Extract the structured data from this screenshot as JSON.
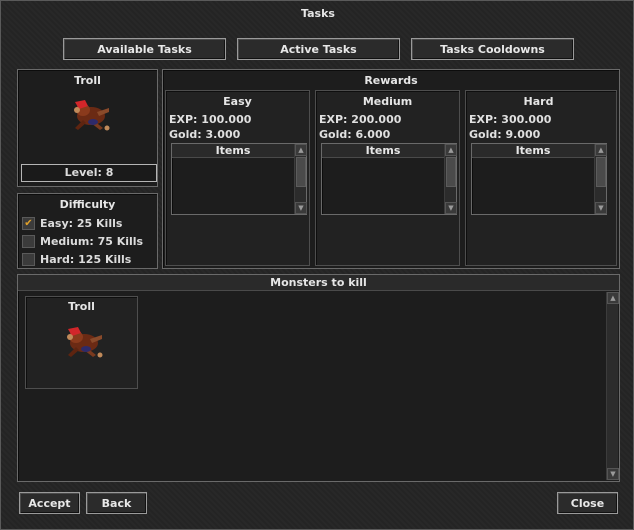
{
  "window": {
    "title": "Tasks"
  },
  "tabs": {
    "available": "Available Tasks",
    "active": "Active Tasks",
    "cooldowns": "Tasks Cooldowns"
  },
  "monster": {
    "name": "Troll",
    "level": "Level: 8"
  },
  "difficulty": {
    "title": "Difficulty",
    "options": [
      {
        "label": "Easy: 25 Kills",
        "checked": true
      },
      {
        "label": "Medium: 75 Kills",
        "checked": false
      },
      {
        "label": "Hard: 125 Kills",
        "checked": false
      }
    ]
  },
  "rewards": {
    "title": "Rewards",
    "items_label": "Items",
    "tiers": [
      {
        "name": "Easy",
        "exp": "EXP: 100.000",
        "gold": "Gold: 3.000"
      },
      {
        "name": "Medium",
        "exp": "EXP: 200.000",
        "gold": "Gold: 6.000"
      },
      {
        "name": "Hard",
        "exp": "EXP: 300.000",
        "gold": "Gold: 9.000"
      }
    ]
  },
  "monsters_to_kill": {
    "title": "Monsters to kill",
    "list": [
      {
        "name": "Troll"
      }
    ]
  },
  "footer": {
    "accept": "Accept",
    "back": "Back",
    "close": "Close"
  },
  "icons": {
    "checkmark": "checkmark-icon",
    "scroll_up": "arrow-up-icon",
    "scroll_down": "arrow-down-icon",
    "monster_sprite": "troll-sprite-icon"
  },
  "colors": {
    "check": "#e0a02a",
    "window_bg": "#252525"
  }
}
